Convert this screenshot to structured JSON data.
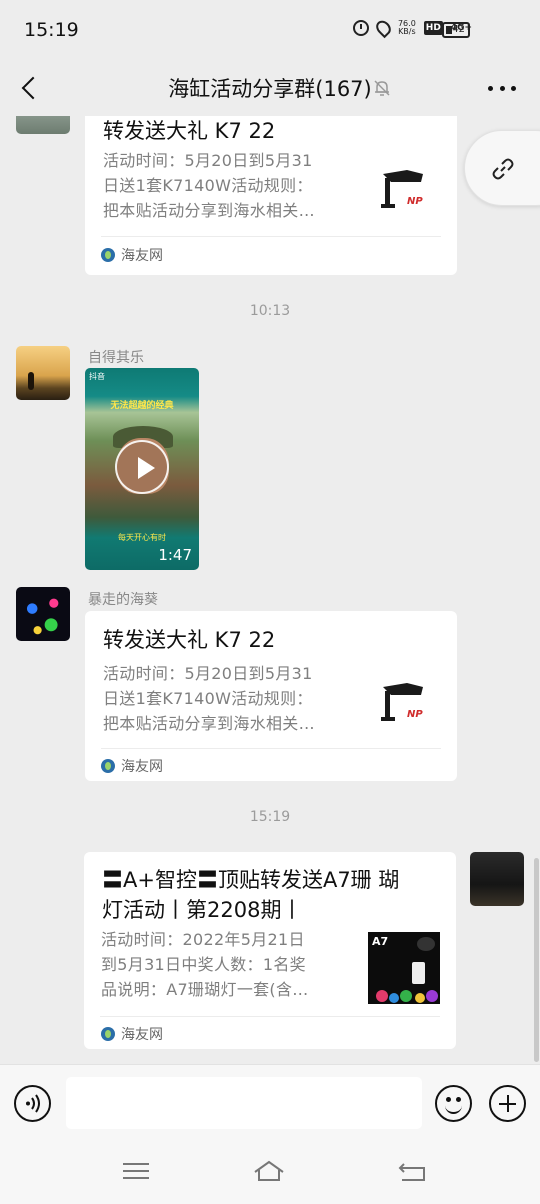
{
  "status_bar": {
    "time": "15:19",
    "net_speed": "76.0",
    "net_unit": "KB/s",
    "hd_badge": "HD",
    "signal": "4G+",
    "battery": "42"
  },
  "nav": {
    "title": "海缸活动分享群(167)",
    "icons": [
      "back-icon",
      "mute-bell-icon",
      "more-icon"
    ]
  },
  "messages": {
    "card_top": {
      "title": "转发送大礼 K7 22",
      "desc_lines": [
        "活动时间：5月20日到5月31",
        "日送1套K7140W活动规则：",
        "把本贴活动分享到海水相关…"
      ],
      "source": "海友网"
    },
    "time_1": "10:13",
    "video_msg": {
      "sender": "自得其乐",
      "app_label": "抖音",
      "caption": "无法超越的经典",
      "bottom_text": "每天开心有时",
      "duration": "1:47"
    },
    "card_mid": {
      "sender": "暴走的海葵",
      "title": "转发送大礼 K7 22",
      "desc_lines": [
        "活动时间：5月20日到5月31",
        "日送1套K7140W活动规则：",
        "把本贴活动分享到海水相关…"
      ],
      "source": "海友网"
    },
    "time_2": "15:19",
    "card_own": {
      "title_lines": [
        "〓A+智控〓顶贴转发送A7珊 瑚",
        "灯活动丨第2208期丨"
      ],
      "desc_lines": [
        "活动时间：2022年5月21日",
        "到5月31日中奖人数：1名奖",
        "品说明：A7珊瑚灯一套(含…"
      ],
      "source": "海友网",
      "thumb_label": "A7"
    }
  },
  "input_bar": {
    "icons": [
      "voice-icon",
      "emoji-icon",
      "plus-icon"
    ]
  },
  "system_nav": {
    "icons": [
      "menu-icon",
      "home-icon",
      "back-return-icon"
    ]
  }
}
